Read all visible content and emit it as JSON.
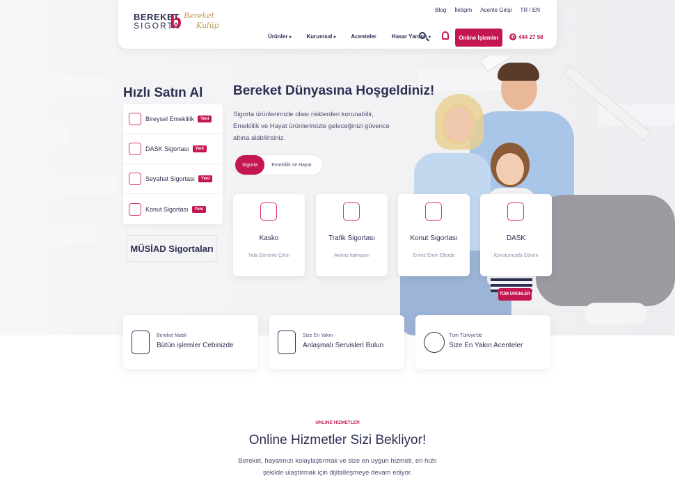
{
  "header": {
    "logo_line1": "BEREKET",
    "logo_line2": "SIGORTA",
    "logo_mark": "b",
    "kulup_line1": "Bereket",
    "kulup_line2": "Kulüp",
    "top_links": [
      "Blog",
      "İletişim",
      "Acente Girişi",
      "TR / EN"
    ],
    "nav": [
      "Ürünler",
      "Kurumsal",
      "Acenteler",
      "Hasar Yardım"
    ],
    "online_button": "Online İşlemler",
    "phone": "444 27 58"
  },
  "quick_buy": {
    "title": "Hızlı Satın Al",
    "items": [
      {
        "label": "Bireysel Emeklilik",
        "badge": "Yeni"
      },
      {
        "label": "DASK Sigortası",
        "badge": "Yeni"
      },
      {
        "label": "Seyahat Sigortası",
        "badge": "Yeni"
      },
      {
        "label": "Konut Sigortası",
        "badge": "Yeni"
      }
    ],
    "musiad": "MÜSİAD Sigortaları"
  },
  "welcome": {
    "title": "Bereket Dünyasına Hoşgeldiniz!",
    "text": "Sigorta ürünlerimizle olası risklerden korunabilir, Emeklilik ve Hayat ürünlerimizle geleceğinizi güvence altına alabilirsiniz.",
    "tabs": [
      "Sigorta",
      "Emeklilik ve Hayat"
    ]
  },
  "products": [
    {
      "title": "Kasko",
      "sub": "Yola Güvenle Çıkın"
    },
    {
      "title": "Trafik Sigortası",
      "sub": "Aklınız kalmasın"
    },
    {
      "title": "Konut Sigortası",
      "sub": "Eviniz Emin Ellerde"
    },
    {
      "title": "DASK",
      "sub": "Konutunuzda Güven"
    }
  ],
  "all_products": "TÜM ÜRÜNLER",
  "services": [
    {
      "small": "Bereket Mobil",
      "big": "Bütün işlemler Cebinizde"
    },
    {
      "small": "Size En Yakın",
      "big": "Anlaşmalı Servisleri Bulun"
    },
    {
      "small": "Tüm Türkiye'de",
      "big": "Size En Yakın Acenteler"
    }
  ],
  "online_section": {
    "label": "ONLINE HİZMETLER",
    "title": "Online Hizmetler Sizi Bekliyor!",
    "text": "Bereket, hayatınızı kolaylaştırmak ve size en uygun hizmeti, en hızlı şekilde ulaştırmak için dijitalleşmeye devam ediyor."
  },
  "colors": {
    "accent": "#c4174f",
    "navy": "#2b2f52",
    "gold": "#b99a5a"
  }
}
